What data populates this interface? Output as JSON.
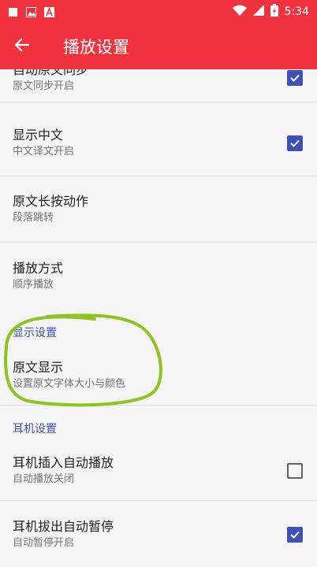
{
  "status": {
    "time": "5:34"
  },
  "appbar": {
    "title": "播放设置"
  },
  "items": [
    {
      "title": "自动原文同步",
      "subtitle": "原文同步开启",
      "checked": true
    },
    {
      "title": "显示中文",
      "subtitle": "中文译文开启",
      "checked": true
    },
    {
      "title": "原文长按动作",
      "subtitle": "段落跳转"
    },
    {
      "title": "播放方式",
      "subtitle": "顺序播放"
    }
  ],
  "display_section": {
    "header": "显示设置",
    "items": [
      {
        "title": "原文显示",
        "subtitle": "设置原文字体大小与颜色"
      }
    ]
  },
  "earphone_section": {
    "header": "耳机设置",
    "items": [
      {
        "title": "耳机插入自动播放",
        "subtitle": "自动播放关闭",
        "checked": false
      },
      {
        "title": "耳机拔出自动暂停",
        "subtitle": "自动暂停开启",
        "checked": true
      }
    ]
  },
  "colors": {
    "appbar": "#f0333f",
    "accent": "#3f51b5",
    "annotation": "#8fc31f"
  }
}
